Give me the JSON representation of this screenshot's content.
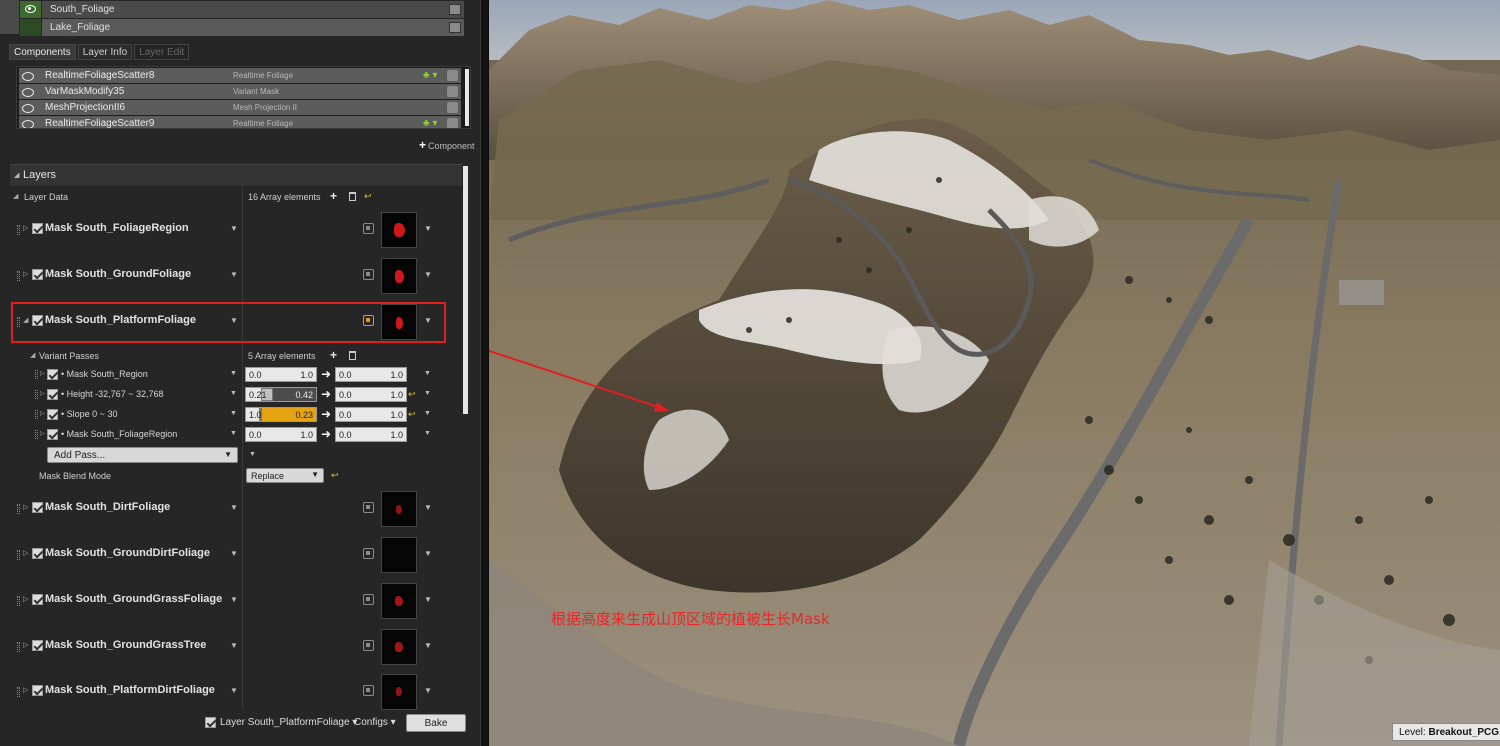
{
  "top_layers": [
    {
      "label": "South_Foliage",
      "visible": true
    },
    {
      "label": "Lake_Foliage",
      "visible": true
    }
  ],
  "tabs": [
    {
      "label": "Components",
      "state": "active"
    },
    {
      "label": "Layer Info",
      "state": "normal"
    },
    {
      "label": "Layer Edit",
      "state": "disabled"
    }
  ],
  "components": [
    {
      "name": "RealtimeFoliageScatter8",
      "type": "Realtime Foliage",
      "tree_icon": true
    },
    {
      "name": "VarMaskModify35",
      "type": "Variant Mask",
      "tree_icon": false
    },
    {
      "name": "MeshProjectionII6",
      "type": "Mesh Projection II",
      "tree_icon": false
    },
    {
      "name": "RealtimeFoliageScatter9",
      "type": "Realtime Foliage",
      "tree_icon": true
    }
  ],
  "add_component_label": "Component",
  "layers_section": {
    "title": "Layers",
    "layer_data_label": "Layer Data",
    "layer_data_count": "16 Array elements"
  },
  "masks": [
    {
      "name": "Mask South_FoliageRegion",
      "active": false
    },
    {
      "name": "Mask South_GroundFoliage",
      "active": false
    },
    {
      "name": "Mask South_PlatformFoliage",
      "active": true
    },
    {
      "name": "Mask South_DirtFoliage",
      "active": false
    },
    {
      "name": "Mask South_GroundDirtFoliage",
      "active": false
    },
    {
      "name": "Mask South_GroundGrassFoliage",
      "active": false
    },
    {
      "name": "Mask South_GroundGrassTree",
      "active": false
    },
    {
      "name": "Mask South_PlatformDirtFoliage",
      "active": false
    }
  ],
  "variant_passes": {
    "label": "Variant Passes",
    "count": "5 Array elements",
    "items": [
      {
        "name": "Mask South_Region",
        "in_min": "0.0",
        "in_max": "1.0",
        "out_min": "0.0",
        "out_max": "1.0",
        "reset": false
      },
      {
        "name": "Height -32,767 ~ 32,768",
        "in_min": "0.21",
        "in_max": "0.42",
        "out_min": "0.0",
        "out_max": "1.0",
        "reset": true
      },
      {
        "name": "Slope 0 ~ 30",
        "in_min": "1.0",
        "in_max": "0.23",
        "out_min": "0.0",
        "out_max": "1.0",
        "reset": true
      },
      {
        "name": "Mask South_FoliageRegion",
        "in_min": "0.0",
        "in_max": "1.0",
        "out_min": "0.0",
        "out_max": "1.0",
        "reset": false
      }
    ],
    "add_pass_label": "Add Pass...",
    "blend_mode_label": "Mask Blend Mode",
    "blend_mode_value": "Replace"
  },
  "bottom_bar": {
    "layer_label": "Layer South_PlatformFoliage",
    "configs_label": "Configs",
    "bake_label": "Bake"
  },
  "viewport": {
    "annotation": "根据高度来生成山顶区域的植被生长Mask",
    "level_prefix": "Level:",
    "level_name": "Breakout_PCG (Pe"
  },
  "colors": {
    "highlight_red": "#e01e1e",
    "slider_orange": "#e5a311",
    "eye_green": "#3d6b2f"
  }
}
